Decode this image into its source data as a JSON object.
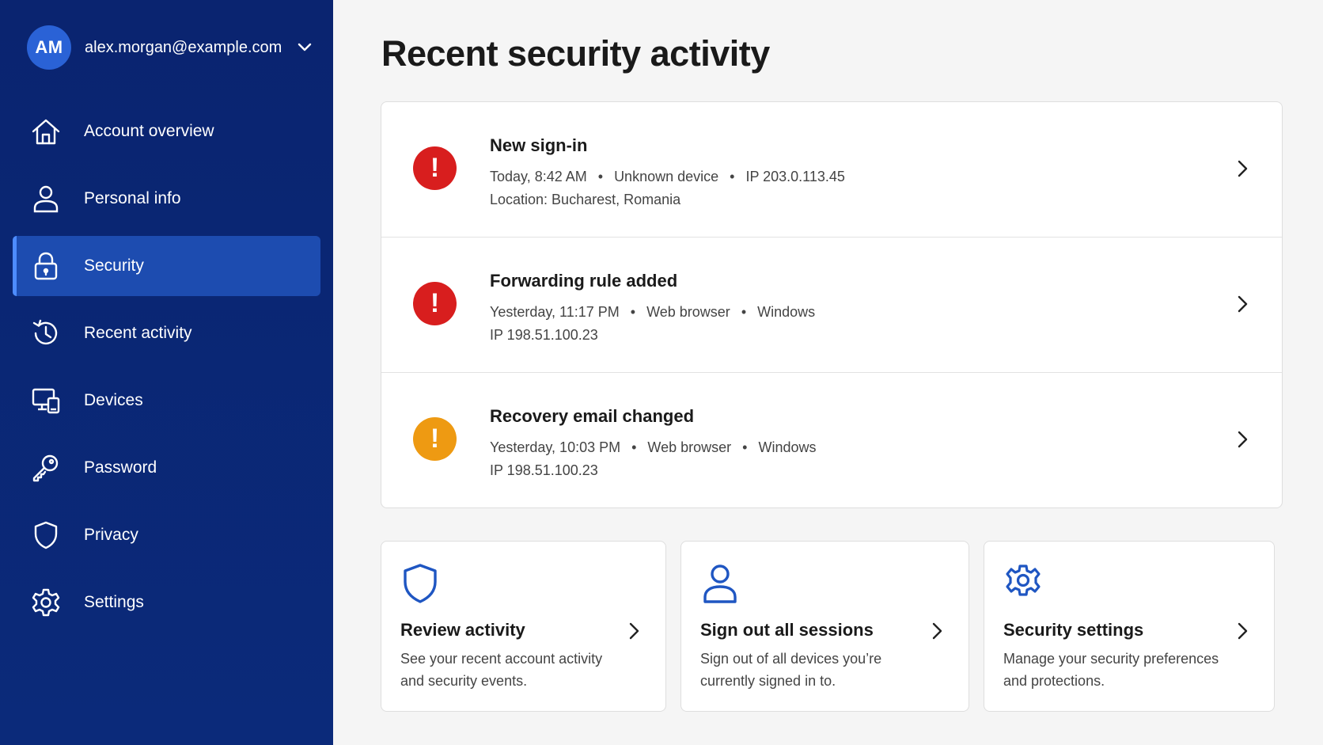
{
  "account": {
    "initials": "AM",
    "email": "alex.morgan@example.com",
    "avatar_color": "#2a62d6"
  },
  "sidebar": {
    "items": [
      {
        "label": "Account overview",
        "icon": "home-icon",
        "active": false
      },
      {
        "label": "Personal info",
        "icon": "person-icon",
        "active": false
      },
      {
        "label": "Security",
        "icon": "lock-icon",
        "active": true
      },
      {
        "label": "Recent activity",
        "icon": "history-icon",
        "active": false
      },
      {
        "label": "Devices",
        "icon": "devices-icon",
        "active": false
      },
      {
        "label": "Password",
        "icon": "key-icon",
        "active": false
      },
      {
        "label": "Privacy",
        "icon": "shield-icon",
        "active": false
      },
      {
        "label": "Settings",
        "icon": "gear-icon",
        "active": false
      }
    ]
  },
  "main": {
    "title": "Recent security activity",
    "events": [
      {
        "title": "New sign-in",
        "time": "Today, 8:42 AM",
        "detail1": "Unknown device",
        "detail2": "IP 203.0.113.45",
        "line2": "Location: Bucharest, Romania",
        "severity": "high",
        "icon": "alert-icon",
        "color": "#d81e1e"
      },
      {
        "title": "Forwarding rule added",
        "time": "Yesterday, 11:17 PM",
        "detail1": "Web browser",
        "detail2": "Windows",
        "line2": "IP 198.51.100.23",
        "severity": "high",
        "icon": "alert-icon",
        "color": "#d81e1e"
      },
      {
        "title": "Recovery email changed",
        "time": "Yesterday, 10:03 PM",
        "detail1": "Web browser",
        "detail2": "Windows",
        "line2": "IP 198.51.100.23",
        "severity": "medium",
        "icon": "alert-icon",
        "color": "#ee9a12"
      }
    ],
    "separator": "•",
    "cards": [
      {
        "title": "Review activity",
        "description": "See your recent account activity and security events.",
        "icon": "shield-icon"
      },
      {
        "title": "Sign out all sessions",
        "description": "Sign out of all devices you’re currently signed in to.",
        "icon": "person-icon"
      },
      {
        "title": "Security settings",
        "description": "Manage your security preferences and protections.",
        "icon": "gear-icon"
      }
    ]
  },
  "colors": {
    "sidebar_bg": "#0a2470",
    "active_item": "#1d4cb0",
    "accent": "#1f56c2"
  }
}
